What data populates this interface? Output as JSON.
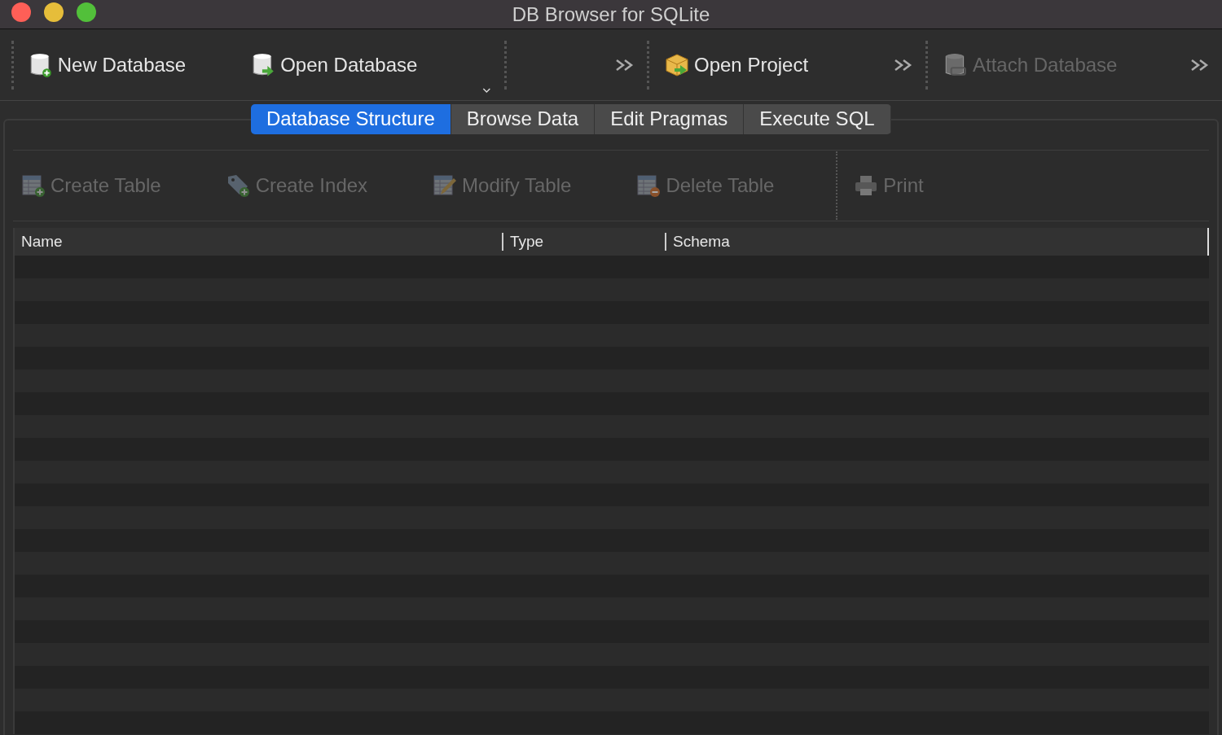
{
  "window": {
    "title": "DB Browser for SQLite"
  },
  "toolbar": {
    "groups": [
      {
        "items": [
          {
            "label": "New Database",
            "kind": "new-db",
            "disabled": false
          },
          {
            "label": "Open Database",
            "kind": "open-db",
            "disabled": false
          },
          {
            "kind": "dropdown"
          }
        ]
      },
      {
        "items": [
          {
            "kind": "overflow"
          }
        ]
      },
      {
        "items": [
          {
            "label": "Open Project",
            "kind": "project",
            "disabled": false
          },
          {
            "kind": "overflow"
          }
        ]
      },
      {
        "items": [
          {
            "label": "Attach Database",
            "kind": "attach",
            "disabled": true
          },
          {
            "kind": "overflow"
          }
        ]
      }
    ]
  },
  "tabs": [
    {
      "label": "Database Structure",
      "selected": true
    },
    {
      "label": "Browse Data",
      "selected": false
    },
    {
      "label": "Edit Pragmas",
      "selected": false
    },
    {
      "label": "Execute SQL",
      "selected": false
    }
  ],
  "structure_toolbar": [
    {
      "label": "Create Table",
      "kind": "create-table",
      "disabled": true
    },
    {
      "label": "Create Index",
      "kind": "create-index",
      "disabled": true
    },
    {
      "label": "Modify Table",
      "kind": "modify-table",
      "disabled": true
    },
    {
      "label": "Delete Table",
      "kind": "delete-table",
      "disabled": true
    },
    {
      "label": "Print",
      "kind": "print",
      "disabled": true
    }
  ],
  "table": {
    "columns": [
      "Name",
      "Type",
      "Schema"
    ]
  }
}
